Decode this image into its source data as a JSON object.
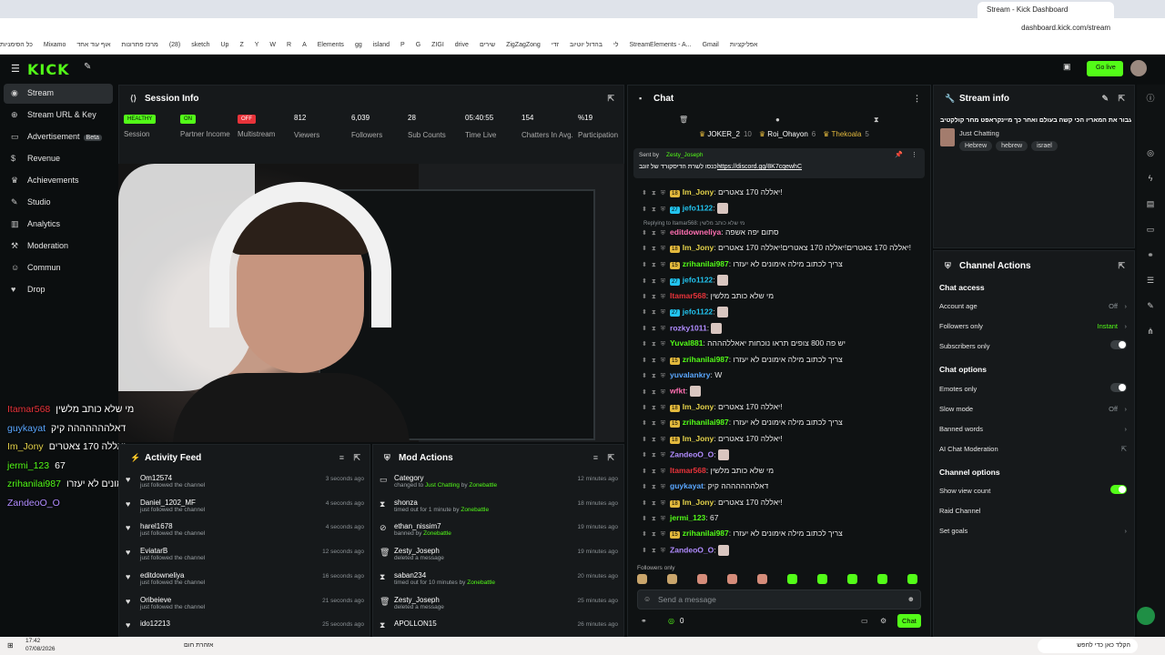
{
  "browser": {
    "tab_title": "Stream - Kick Dashboard",
    "url": "dashboard.kick.com/stream",
    "bookmarks": [
      "כל הסימניות",
      "Mixamo",
      "אוף עוד אחד",
      "מרכז פתרונות",
      "(28)",
      "sketch",
      "Up",
      "Z",
      "Y",
      "W",
      "R",
      "A",
      "Elements",
      "gg",
      "island",
      "P",
      "G",
      "ZIGI",
      "drive",
      "שירים",
      "ZigZagZong",
      "זדי",
      "בהדול יוטיוב",
      "לי",
      "StreamElements - A...",
      "Gmail",
      "אפליקציות"
    ]
  },
  "top": {
    "logo": "KICK",
    "go_live": "Go live"
  },
  "sidebar": {
    "items": [
      {
        "label": "Stream",
        "icon": "radio-icon"
      },
      {
        "label": "Stream URL & Key",
        "icon": "globe-icon"
      },
      {
        "label": "Advertisement",
        "badge": "Beta",
        "icon": "tv-icon"
      },
      {
        "label": "Revenue",
        "icon": "dollar-icon"
      },
      {
        "label": "Achievements",
        "icon": "trophy-icon"
      },
      {
        "label": "Studio",
        "icon": "brush-icon"
      },
      {
        "label": "Analytics",
        "icon": "chart-icon"
      },
      {
        "label": "Moderation",
        "icon": "hammer-icon"
      },
      {
        "label": "Commun",
        "icon": "users-icon"
      },
      {
        "label": "Drop",
        "icon": "gift-icon"
      }
    ]
  },
  "session": {
    "title": "Session Info",
    "stats": [
      {
        "value": "HEALTHY",
        "label": "Session",
        "badge_color": "#53fc18"
      },
      {
        "value": "ON",
        "label": "Partner Income",
        "badge_color": "#53fc18"
      },
      {
        "value": "OFF",
        "label": "Multistream",
        "badge_color": "#e8333a"
      },
      {
        "value": "812",
        "label": "Viewers"
      },
      {
        "value": "6,039",
        "label": "Followers"
      },
      {
        "value": "28",
        "label": "Sub Counts"
      },
      {
        "value": "05:40:55",
        "label": "Time Live"
      },
      {
        "value": "154",
        "label": "Chatters In Avg."
      },
      {
        "value": "%19",
        "label": "Participation"
      }
    ]
  },
  "overlay_chat": [
    {
      "user": "Itamar568",
      "text": "מי שלא כותב מלשין",
      "color": "#e8333a"
    },
    {
      "user": "guykayat",
      "text": "דאלההההההה קיק",
      "color": "#5aa7ff"
    },
    {
      "user": "Im_Jony",
      "text": "יאללה 170 צאטרים",
      "color": "#e3d14a"
    },
    {
      "user": "jermi_123",
      "text": "67",
      "color": "#53fc18"
    },
    {
      "user": "zrihanilai987",
      "text": "צריך לכתוב מילה אימונים לא יעזרו",
      "color": "#53fc18"
    },
    {
      "user": "ZandeoO_O",
      "text": "",
      "color": "#b18cff"
    }
  ],
  "activity": {
    "title": "Activity Feed",
    "rows": [
      {
        "name": "Om12574",
        "sub": "just followed the channel",
        "time": "3 seconds ago"
      },
      {
        "name": "Daniel_1202_MF",
        "sub": "just followed the channel",
        "time": "4 seconds ago"
      },
      {
        "name": "harel1678",
        "sub": "just followed the channel",
        "time": "4 seconds ago"
      },
      {
        "name": "EviatarB",
        "sub": "just followed the channel",
        "time": "12 seconds ago"
      },
      {
        "name": "editdowneliya",
        "sub": "just followed the channel",
        "time": "16 seconds ago"
      },
      {
        "name": "Oribeieve",
        "sub": "just followed the channel",
        "time": "21 seconds ago"
      },
      {
        "name": "ido12213",
        "sub": "",
        "time": "25 seconds ago"
      }
    ]
  },
  "mod": {
    "title": "Mod Actions",
    "rows": [
      {
        "name": "Category",
        "sub_pre": "changed to ",
        "sub_hl": "Just Chatting",
        "sub_mid": " by ",
        "sub_by": "Zonebattle",
        "time": "12 minutes ago",
        "icon": "folder-icon"
      },
      {
        "name": "shonza",
        "sub_pre": "timed out for 1 minute by ",
        "sub_hl": "",
        "sub_mid": "",
        "sub_by": "Zonebattle",
        "time": "18 minutes ago",
        "icon": "hourglass-icon"
      },
      {
        "name": "ethan_nissim7",
        "sub_pre": "banned by ",
        "sub_hl": "",
        "sub_mid": "",
        "sub_by": "Zonebattle",
        "time": "19 minutes ago",
        "icon": "ban-icon"
      },
      {
        "name": "Zesty_Joseph",
        "sub_pre": "deleted a message",
        "sub_hl": "",
        "sub_mid": "",
        "sub_by": "",
        "time": "19 minutes ago",
        "icon": "trash-icon"
      },
      {
        "name": "saban234",
        "sub_pre": "timed out for 10 minutes by ",
        "sub_hl": "",
        "sub_mid": "",
        "sub_by": "Zonebattle",
        "time": "20 minutes ago",
        "icon": "hourglass-icon"
      },
      {
        "name": "Zesty_Joseph",
        "sub_pre": "deleted a message",
        "sub_hl": "",
        "sub_mid": "",
        "sub_by": "",
        "time": "25 minutes ago",
        "icon": "trash-icon"
      },
      {
        "name": "APOLLON15",
        "sub_pre": "",
        "sub_hl": "",
        "sub_mid": "",
        "sub_by": "",
        "time": "26 minutes ago",
        "icon": "hourglass-icon"
      }
    ]
  },
  "chat": {
    "title": "Chat",
    "top_gifters": [
      {
        "name": "JOKER_2",
        "count": "10"
      },
      {
        "name": "Roi_Ohayon",
        "count": "6"
      },
      {
        "name": "Thekoala",
        "count": "5"
      }
    ],
    "pinned": {
      "by_label": "Sent by",
      "by": "Zesty_Joseph",
      "text": "כנסו לשרת הדיסקורד של זונב -",
      "link": "https://discord.gg/8K7cqewhC"
    },
    "reply_note": "Replying to Itamar568: מי שלא כותב מלשין",
    "messages": [
      {
        "user": "Im_Jony",
        "text": "יאללה 170 צאטרים!",
        "color": "#e3d14a",
        "lvl": "18"
      },
      {
        "user": "jefo1122",
        "text": "",
        "color": "#22c3ee",
        "lvl": "27",
        "emote": true
      },
      {
        "user": "editdowneliya",
        "text": "סתום יפה אשפה",
        "color": "#ff6fb1",
        "lvl": ""
      },
      {
        "user": "Im_Jony",
        "text": "יאללה 170 צאטרים!יאללה 170 צאטרים!יאללה 170 צאטרים!",
        "color": "#e3d14a",
        "lvl": "18"
      },
      {
        "user": "zrihanilai987",
        "text": "צריך לכתוב מילה אימונים לא יעזרו",
        "color": "#53fc18",
        "lvl": "15"
      },
      {
        "user": "jefo1122",
        "text": "",
        "color": "#22c3ee",
        "lvl": "27",
        "emote": true
      },
      {
        "user": "Itamar568",
        "text": "מי שלא כותב מלשין",
        "color": "#e8333a",
        "lvl": ""
      },
      {
        "user": "jefo1122",
        "text": "",
        "color": "#22c3ee",
        "lvl": "27",
        "emote": true
      },
      {
        "user": "rozky1011",
        "text": "",
        "color": "#b18cff",
        "lvl": "",
        "emote": true
      },
      {
        "user": "Yuval881",
        "text": "יש פה 800 צופים תראו נוכחות יאאללהההה",
        "color": "#53fc18",
        "lvl": ""
      },
      {
        "user": "zrihanilai987",
        "text": "צריך לכתוב מילה אימונים לא יעזרו",
        "color": "#53fc18",
        "lvl": "15"
      },
      {
        "user": "yuvalankry",
        "text": "W",
        "color": "#5aa7ff",
        "lvl": ""
      },
      {
        "user": "wfkt",
        "text": "",
        "color": "#ff6fb1",
        "lvl": "",
        "emote": true
      },
      {
        "user": "Im_Jony",
        "text": "יאללה 170 צאטרים!",
        "color": "#e3d14a",
        "lvl": "18"
      },
      {
        "user": "zrihanilai987",
        "text": "צריך לכתוב מילה אימונים לא יעזרו",
        "color": "#53fc18",
        "lvl": "15"
      },
      {
        "user": "Im_Jony",
        "text": "יאללה 170 צאטרים!",
        "color": "#e3d14a",
        "lvl": "18"
      },
      {
        "user": "ZandeoO_O",
        "text": "",
        "color": "#b18cff",
        "lvl": "",
        "emote": true
      },
      {
        "user": "Itamar568",
        "text": "מי שלא כותב מלשין",
        "color": "#e8333a",
        "lvl": ""
      },
      {
        "user": "guykayat",
        "text": "דאלההההההה קיק",
        "color": "#5aa7ff",
        "lvl": ""
      },
      {
        "user": "Im_Jony",
        "text": "יאללה 170 צאטרים!",
        "color": "#e3d14a",
        "lvl": "18"
      },
      {
        "user": "jermi_123",
        "text": "67",
        "color": "#53fc18",
        "lvl": ""
      },
      {
        "user": "zrihanilai987",
        "text": "צריך לכתוב מילה אימונים לא יעזרו",
        "color": "#53fc18",
        "lvl": "15"
      },
      {
        "user": "ZandeoO_O",
        "text": "",
        "color": "#b18cff",
        "lvl": "",
        "emote": true
      }
    ],
    "followers_only": "Followers only",
    "placeholder": "Send a message",
    "points": "0",
    "send": "Chat"
  },
  "stream_info": {
    "title": "Stream info",
    "stream_title": "מנסה לעבור את המאריו הכי קשה בעולם ואחר כך מיינקראפט מחר קולקטיב",
    "category": "Just Chatting",
    "tags": [
      "Hebrew",
      "hebrew",
      "israel"
    ]
  },
  "channel_actions": {
    "title": "Channel Actions",
    "chat_access": "Chat access",
    "account_age": {
      "label": "Account age",
      "value": "Off"
    },
    "followers_only": {
      "label": "Followers only",
      "value": "Instant"
    },
    "subscribers_only": {
      "label": "Subscribers only"
    },
    "chat_options": "Chat options",
    "emotes_only": {
      "label": "Emotes only"
    },
    "slow_mode": {
      "label": "Slow mode",
      "value": "Off"
    },
    "banned_words": {
      "label": "Banned words"
    },
    "ai_moderation": {
      "label": "AI Chat Moderation"
    },
    "channel_options": "Channel options",
    "show_view_count": {
      "label": "Show view count"
    },
    "raid_channel": {
      "label": "Raid Channel"
    },
    "set_goals": {
      "label": "Set goals"
    }
  },
  "taskbar": {
    "time": "17:42",
    "date": "07/08/2026",
    "search": "הקלד כאן כדי לחפש",
    "weather": "אזהרת חום"
  }
}
